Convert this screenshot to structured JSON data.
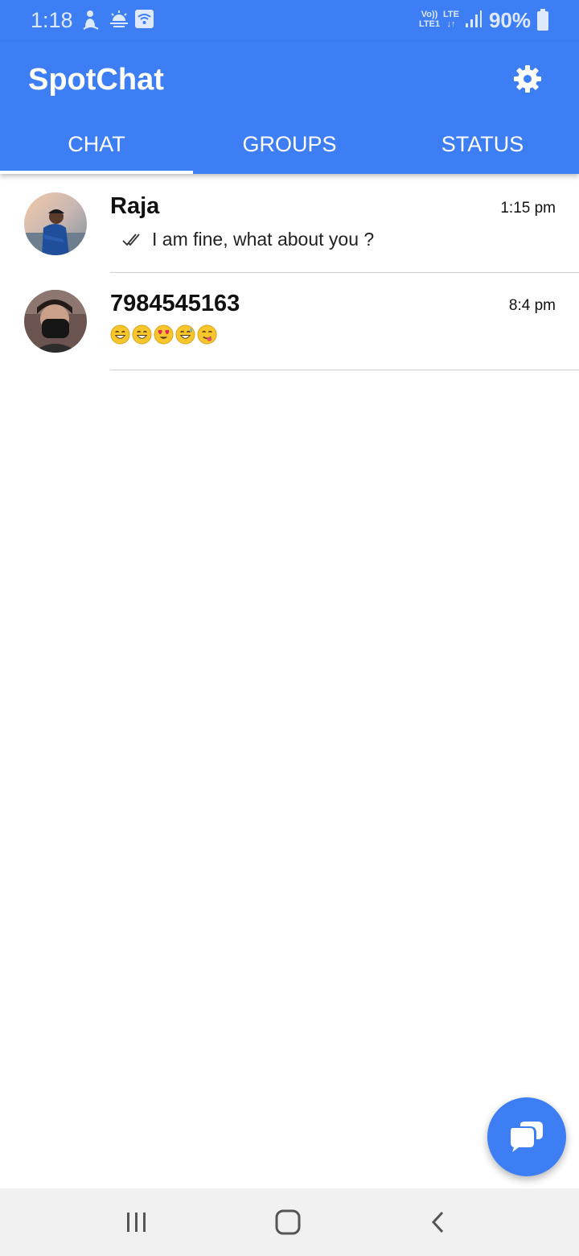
{
  "status_bar": {
    "time": "1:18",
    "battery_percent": "90%",
    "network_top": "Vo))",
    "network_bottom": "LTE1",
    "lte_label": "LTE",
    "icons": [
      "person-notification-icon",
      "weather-icon",
      "wifi-icon",
      "signal-icon",
      "battery-icon"
    ]
  },
  "app": {
    "title": "SpotChat",
    "accent_color": "#3d7ef5",
    "settings_icon": "gear-icon"
  },
  "tabs": [
    {
      "label": "CHAT",
      "active": true
    },
    {
      "label": "GROUPS",
      "active": false
    },
    {
      "label": "STATUS",
      "active": false
    }
  ],
  "chats": [
    {
      "name": "Raja",
      "time": "1:15 pm",
      "message": "I am fine, what about you ?",
      "read_ticks": true
    },
    {
      "name": "7984545163",
      "time": "8:4 pm",
      "message_emojis": [
        "grin-icon",
        "grin-icon",
        "heart-eyes-icon",
        "sweat-smile-icon",
        "yum-icon"
      ]
    }
  ],
  "fab": {
    "icon": "chat-bubble-icon"
  },
  "nav": {
    "buttons": [
      "recents-icon",
      "home-icon",
      "back-icon"
    ]
  }
}
